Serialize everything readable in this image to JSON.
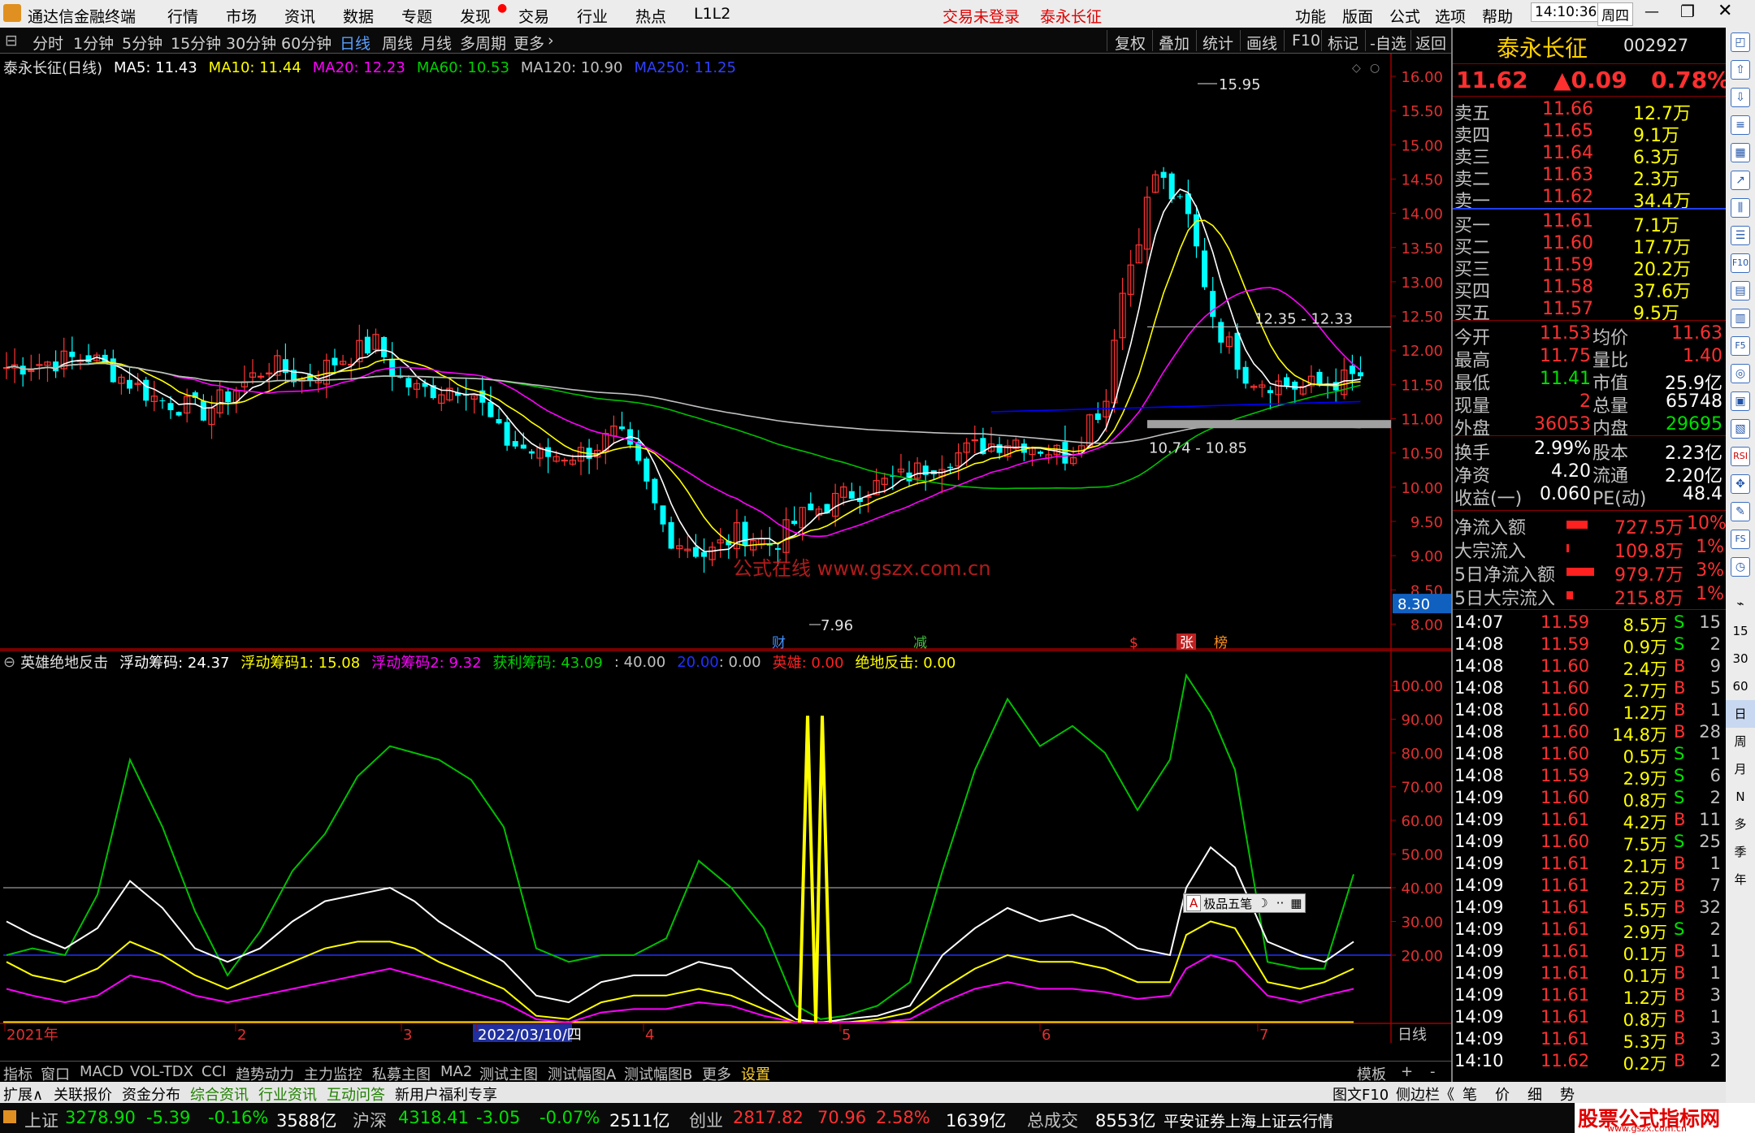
{
  "app": {
    "title": "通达信金融终端",
    "menus": [
      "行情",
      "市场",
      "资讯",
      "数据",
      "专题",
      "发现",
      "交易",
      "行业",
      "热点",
      "L1L2"
    ],
    "menus_right": [
      "功能",
      "版面",
      "公式",
      "选项",
      "帮助"
    ],
    "trade_status": "交易未登录",
    "stock_title": "泰永长征",
    "clock": "14:10:36",
    "weekday": "周四"
  },
  "period_tabs": [
    "分时",
    "1分钟",
    "5分钟",
    "15分钟",
    "30分钟",
    "60分钟",
    "日线",
    "周线",
    "月线",
    "多周期",
    "更多"
  ],
  "period_active": "日线",
  "tools": [
    "复权",
    "叠加",
    "统计",
    "画线",
    "F10",
    "标记",
    "-自选",
    "返回"
  ],
  "legend": {
    "name": "泰永长征(日线)",
    "ma5": "MA5: 11.43",
    "ma10": "MA10: 11.44",
    "ma20": "MA20: 12.23",
    "ma60": "MA60: 10.53",
    "ma120": "MA120: 10.90",
    "ma250": "MA250: 11.25"
  },
  "main_axis": {
    "ticks": [
      "16.00",
      "15.50",
      "15.00",
      "14.50",
      "14.00",
      "13.50",
      "13.00",
      "12.50",
      "12.00",
      "11.50",
      "11.00",
      "10.50",
      "10.00",
      "9.50",
      "9.00",
      "8.50",
      "8.00"
    ],
    "cursor_price": "8.30"
  },
  "annotations": {
    "high": "15.95",
    "low": "7.96",
    "range_top": "12.35 - 12.33",
    "range_bottom": "10.74 - 10.85",
    "watermark": "公式在线 www.gszx.com.cn",
    "events": [
      "财",
      "减",
      "$",
      "张",
      "榜"
    ]
  },
  "ind": {
    "name": "英雄绝地反击",
    "floating": "浮动筹码: 24.37",
    "f1": "浮动筹码1: 15.08",
    "f2": "浮动筹码2: 9.32",
    "profit": "获利筹码: 43.09",
    "c40": ": 40.00",
    "c20": "20.00",
    "c0": ": 0.00",
    "hero": "英雄: 0.00",
    "strike": "绝地反击: 0.00",
    "ticks": [
      "100.00",
      "90.00",
      "80.00",
      "70.00",
      "60.00",
      "50.00",
      "40.00",
      "30.00",
      "20.00"
    ],
    "toolbox": "极品五笔"
  },
  "time_axis": [
    "2021年",
    "2",
    "3",
    "2022/03/10/四",
    "4",
    "5",
    "6",
    "7"
  ],
  "time_axis_right": "日线",
  "bottom_tabs": [
    "指标",
    "窗口",
    "MACD",
    "VOL-TDX",
    "CCI",
    "趋势动力",
    "主力监控",
    "私募主图",
    "MA2",
    "测试主图",
    "测试幅图A",
    "测试幅图B",
    "更多",
    "设置"
  ],
  "bottom_right": [
    "模板",
    "+",
    "-"
  ],
  "tabs2": [
    "扩展∧",
    "关联报价",
    "资金分布",
    "综合资讯",
    "行业资讯",
    "互动问答",
    "新用户福利专享"
  ],
  "tabs2_right": [
    "图文F10",
    "侧边栏《",
    "笔",
    "价",
    "细",
    "势"
  ],
  "status": {
    "sh_name": "上证",
    "sh": "3278.90",
    "sh_chg": "-5.39",
    "sh_pct": "-0.16%",
    "sh_amt": "3588亿",
    "sz_name": "沪深",
    "sz": "4318.41",
    "sz_chg": "-3.05",
    "sz_pct": "-0.07%",
    "sz_amt": "2511亿",
    "cy_name": "创业",
    "cy": "2817.82",
    "cy_chg": "70.96",
    "cy_pct": "2.58%",
    "cy_amt": "1639亿",
    "total_name": "总成交",
    "total": "8553亿",
    "server": "平安证券上海上证云行情",
    "brand": "股票公式指标网",
    "brand_url": "www.gszx.com.cn"
  },
  "quote": {
    "name": "泰永长征",
    "code": "002927",
    "price": "11.62",
    "change": "▲0.09",
    "pct": "0.78%",
    "asks": [
      {
        "l": "卖五",
        "p": "11.66",
        "v": "12.7万"
      },
      {
        "l": "卖四",
        "p": "11.65",
        "v": "9.1万"
      },
      {
        "l": "卖三",
        "p": "11.64",
        "v": "6.3万"
      },
      {
        "l": "卖二",
        "p": "11.63",
        "v": "2.3万"
      },
      {
        "l": "卖一",
        "p": "11.62",
        "v": "34.4万"
      }
    ],
    "bids": [
      {
        "l": "买一",
        "p": "11.61",
        "v": "7.1万"
      },
      {
        "l": "买二",
        "p": "11.60",
        "v": "17.7万"
      },
      {
        "l": "买三",
        "p": "11.59",
        "v": "20.2万"
      },
      {
        "l": "买四",
        "p": "11.58",
        "v": "37.6万"
      },
      {
        "l": "买五",
        "p": "11.57",
        "v": "9.5万"
      }
    ],
    "stats": [
      {
        "l": "今开",
        "v": "11.53",
        "c": "red",
        "l2": "均价",
        "v2": "11.63",
        "c2": "red"
      },
      {
        "l": "最高",
        "v": "11.75",
        "c": "red",
        "l2": "量比",
        "v2": "1.40",
        "c2": "red"
      },
      {
        "l": "最低",
        "v": "11.41",
        "c": "grn",
        "l2": "市值",
        "v2": "25.9亿",
        "c2": "wht"
      },
      {
        "l": "现量",
        "v": "2",
        "c": "red",
        "l2": "总量",
        "v2": "65748",
        "c2": "wht"
      },
      {
        "l": "外盘",
        "v": "36053",
        "c": "red",
        "l2": "内盘",
        "v2": "29695",
        "c2": "grn"
      }
    ],
    "stats2": [
      {
        "l": "换手",
        "v": "2.99%",
        "l2": "股本",
        "v2": "2.23亿"
      },
      {
        "l": "净资",
        "v": "4.20",
        "l2": "流通",
        "v2": "2.20亿"
      },
      {
        "l": "收益(一)",
        "v": "0.060",
        "l2": "PE(动)",
        "v2": "48.4"
      }
    ],
    "flows": [
      {
        "l": "净流入额",
        "v": "727.5万",
        "p": "10%",
        "w": 26
      },
      {
        "l": "大宗流入",
        "v": "109.8万",
        "p": "1%",
        "w": 3
      },
      {
        "l": "5日净流入额",
        "v": "979.7万",
        "p": "3%",
        "w": 34
      },
      {
        "l": "5日大宗流入",
        "v": "215.8万",
        "p": "1%",
        "w": 8
      }
    ],
    "ticks": [
      {
        "t": "14:07",
        "p": "11.59",
        "v": "8.5万",
        "d": "S",
        "n": "15"
      },
      {
        "t": "14:08",
        "p": "11.59",
        "v": "0.9万",
        "d": "S",
        "n": "2"
      },
      {
        "t": "14:08",
        "p": "11.60",
        "v": "2.4万",
        "d": "B",
        "n": "9"
      },
      {
        "t": "14:08",
        "p": "11.60",
        "v": "2.7万",
        "d": "B",
        "n": "5"
      },
      {
        "t": "14:08",
        "p": "11.60",
        "v": "1.2万",
        "d": "B",
        "n": "1"
      },
      {
        "t": "14:08",
        "p": "11.60",
        "v": "14.8万",
        "d": "B",
        "n": "28"
      },
      {
        "t": "14:08",
        "p": "11.60",
        "v": "0.5万",
        "d": "S",
        "n": "1"
      },
      {
        "t": "14:08",
        "p": "11.59",
        "v": "2.9万",
        "d": "S",
        "n": "6"
      },
      {
        "t": "14:09",
        "p": "11.60",
        "v": "0.8万",
        "d": "S",
        "n": "2"
      },
      {
        "t": "14:09",
        "p": "11.61",
        "v": "4.2万",
        "d": "B",
        "n": "11"
      },
      {
        "t": "14:09",
        "p": "11.60",
        "v": "7.5万",
        "d": "S",
        "n": "25"
      },
      {
        "t": "14:09",
        "p": "11.61",
        "v": "2.1万",
        "d": "B",
        "n": "1"
      },
      {
        "t": "14:09",
        "p": "11.61",
        "v": "2.2万",
        "d": "B",
        "n": "7"
      },
      {
        "t": "14:09",
        "p": "11.61",
        "v": "5.5万",
        "d": "B",
        "n": "32"
      },
      {
        "t": "14:09",
        "p": "11.61",
        "v": "2.9万",
        "d": "S",
        "n": "2"
      },
      {
        "t": "14:09",
        "p": "11.61",
        "v": "0.1万",
        "d": "B",
        "n": "1"
      },
      {
        "t": "14:09",
        "p": "11.61",
        "v": "0.1万",
        "d": "B",
        "n": "1"
      },
      {
        "t": "14:09",
        "p": "11.61",
        "v": "1.2万",
        "d": "B",
        "n": "3"
      },
      {
        "t": "14:09",
        "p": "11.61",
        "v": "0.8万",
        "d": "B",
        "n": "1"
      },
      {
        "t": "14:09",
        "p": "11.61",
        "v": "5.3万",
        "d": "B",
        "n": "3"
      },
      {
        "t": "14:10",
        "p": "11.62",
        "v": "0.2万",
        "d": "B",
        "n": "2"
      }
    ]
  },
  "sidebar_labels": [
    "日",
    "周",
    "月",
    "N",
    "多",
    "季",
    "年"
  ],
  "sidebar_nums": [
    "15",
    "30",
    "60"
  ],
  "colors": {
    "up": "#ff3333",
    "down": "#00ffff",
    "ma5": "#ffffff",
    "ma10": "#ffff00",
    "ma20": "#ff00ff",
    "ma60": "#00c000",
    "ma120": "#c0c0c0",
    "ma250": "#0000ff"
  }
}
